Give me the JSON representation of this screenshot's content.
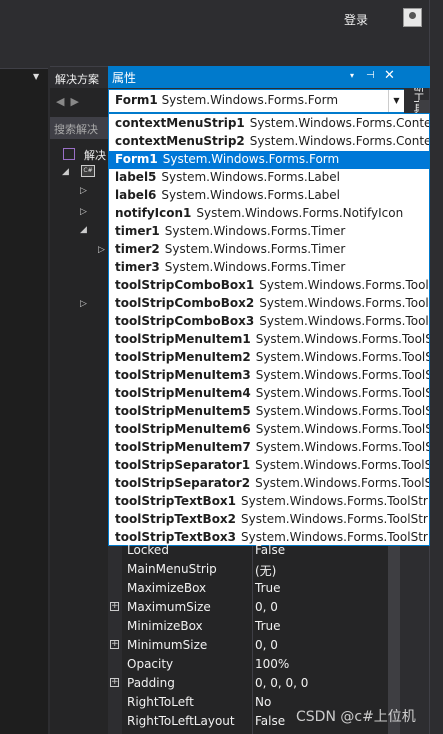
{
  "header": {
    "login_label": "登录"
  },
  "solution_explorer": {
    "tab_label": "解决方案",
    "nav_glyphs": "◀▶",
    "search_placeholder": "搜索解决",
    "solution_label": "解决",
    "project_icon_text": "C#"
  },
  "properties": {
    "title": "属性",
    "dropdown_glyph": "▾",
    "pin_glyph": "⊣",
    "close_glyph": "✕",
    "selected_object": {
      "name": "Form1",
      "type": "System.Windows.Forms.Form"
    },
    "object_list": [
      {
        "name": "contextMenuStrip1",
        "type": "System.Windows.Forms.ContextMenuStrip"
      },
      {
        "name": "contextMenuStrip2",
        "type": "System.Windows.Forms.ContextMenuStrip"
      },
      {
        "name": "Form1",
        "type": "System.Windows.Forms.Form"
      },
      {
        "name": "label5",
        "type": "System.Windows.Forms.Label"
      },
      {
        "name": "label6",
        "type": "System.Windows.Forms.Label"
      },
      {
        "name": "notifyIcon1",
        "type": "System.Windows.Forms.NotifyIcon"
      },
      {
        "name": "timer1",
        "type": "System.Windows.Forms.Timer"
      },
      {
        "name": "timer2",
        "type": "System.Windows.Forms.Timer"
      },
      {
        "name": "timer3",
        "type": "System.Windows.Forms.Timer"
      },
      {
        "name": "toolStripComboBox1",
        "type": "System.Windows.Forms.ToolStripComboBox"
      },
      {
        "name": "toolStripComboBox2",
        "type": "System.Windows.Forms.ToolStripComboBox"
      },
      {
        "name": "toolStripComboBox3",
        "type": "System.Windows.Forms.ToolStripComboBox"
      },
      {
        "name": "toolStripMenuItem1",
        "type": "System.Windows.Forms.ToolStripMenuItem"
      },
      {
        "name": "toolStripMenuItem2",
        "type": "System.Windows.Forms.ToolStripMenuItem"
      },
      {
        "name": "toolStripMenuItem3",
        "type": "System.Windows.Forms.ToolStripMenuItem"
      },
      {
        "name": "toolStripMenuItem4",
        "type": "System.Windows.Forms.ToolStripMenuItem"
      },
      {
        "name": "toolStripMenuItem5",
        "type": "System.Windows.Forms.ToolStripMenuItem"
      },
      {
        "name": "toolStripMenuItem6",
        "type": "System.Windows.Forms.ToolStripMenuItem"
      },
      {
        "name": "toolStripMenuItem7",
        "type": "System.Windows.Forms.ToolStripMenuItem"
      },
      {
        "name": "toolStripSeparator1",
        "type": "System.Windows.Forms.ToolStripSeparator"
      },
      {
        "name": "toolStripSeparator2",
        "type": "System.Windows.Forms.ToolStripSeparator"
      },
      {
        "name": "toolStripTextBox1",
        "type": "System.Windows.Forms.ToolStripTextBox"
      },
      {
        "name": "toolStripTextBox2",
        "type": "System.Windows.Forms.ToolStripTextBox"
      },
      {
        "name": "toolStripTextBox3",
        "type": "System.Windows.Forms.ToolStripTextBox"
      }
    ],
    "selected_index": 2,
    "grid": [
      {
        "key": "Locked",
        "value": "False",
        "expandable": false
      },
      {
        "key": "MainMenuStrip",
        "value": "(无)",
        "expandable": false
      },
      {
        "key": "MaximizeBox",
        "value": "True",
        "expandable": false
      },
      {
        "key": "MaximumSize",
        "value": "0, 0",
        "expandable": true
      },
      {
        "key": "MinimizeBox",
        "value": "True",
        "expandable": false
      },
      {
        "key": "MinimumSize",
        "value": "0, 0",
        "expandable": true
      },
      {
        "key": "Opacity",
        "value": "100%",
        "expandable": false
      },
      {
        "key": "Padding",
        "value": "0, 0, 0, 0",
        "expandable": true
      },
      {
        "key": "RightToLeft",
        "value": "No",
        "expandable": false
      },
      {
        "key": "RightToLeftLayout",
        "value": "False",
        "expandable": false
      }
    ]
  },
  "diagnostics_tab": {
    "label": "诊断工具"
  },
  "watermark": "CSDN @c#上位机",
  "colors": {
    "accent": "#007acc",
    "selection": "#0078d7",
    "background": "#2d2d30",
    "scroll_green": "#31b12c"
  }
}
